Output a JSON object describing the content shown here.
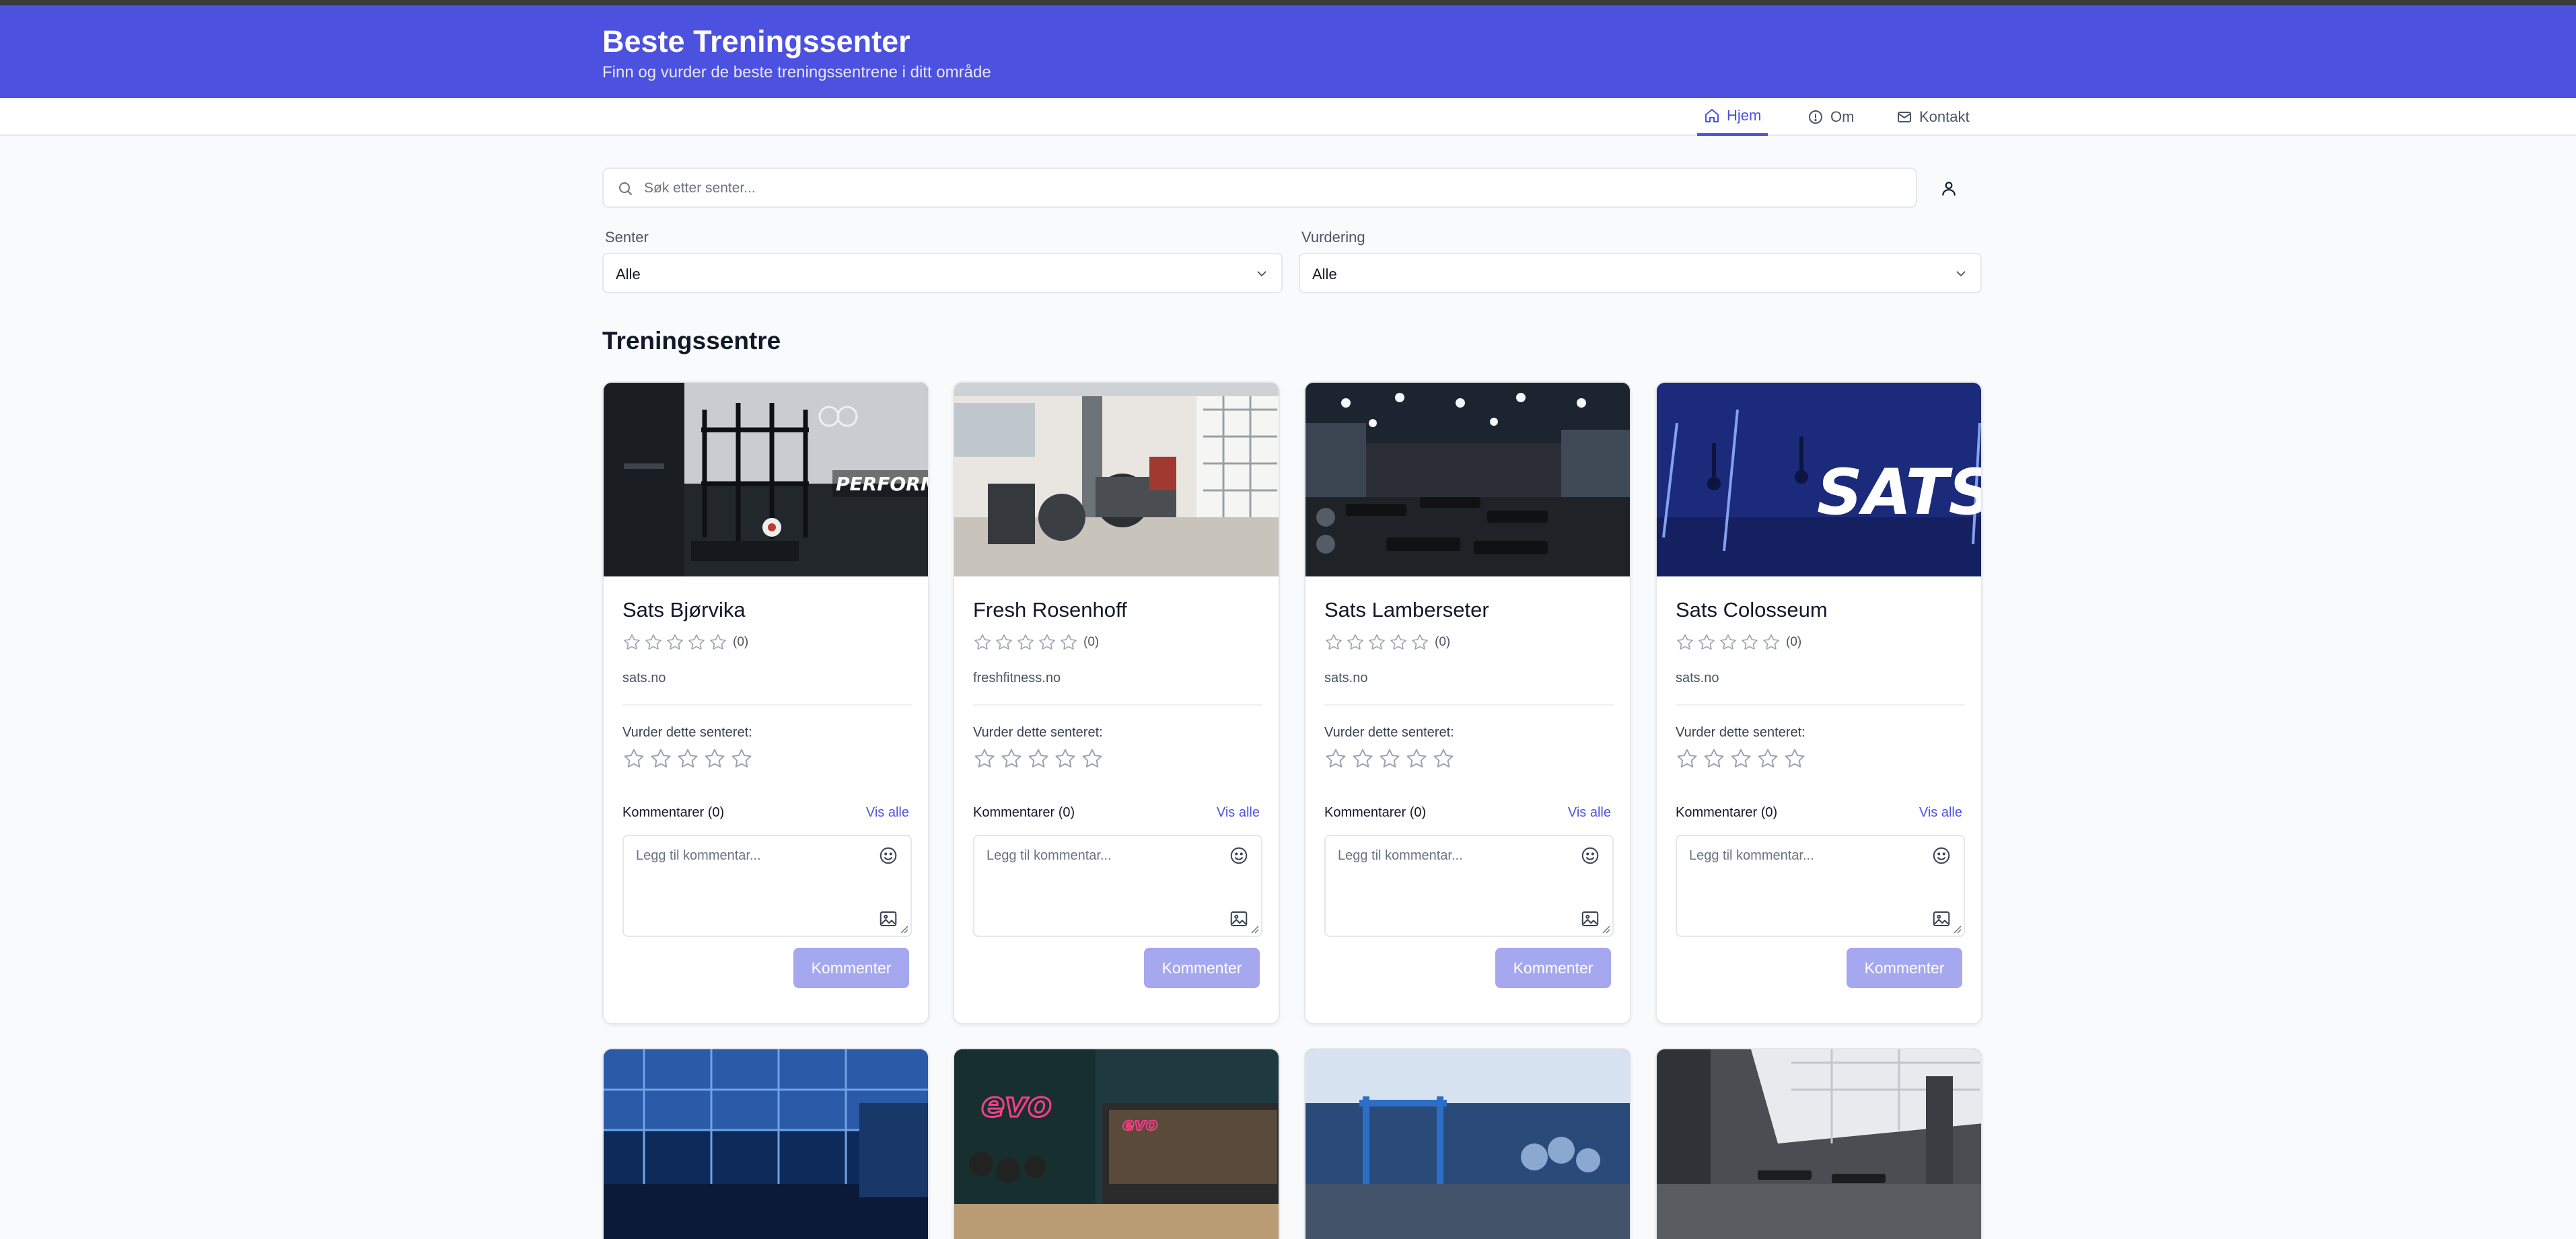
{
  "header": {
    "title": "Beste Treningssenter",
    "subtitle": "Finn og vurder de beste treningssentrene i ditt område"
  },
  "nav": {
    "items": [
      {
        "label": "Hjem",
        "icon": "home-icon",
        "active": true
      },
      {
        "label": "Om",
        "icon": "info-icon",
        "active": false
      },
      {
        "label": "Kontakt",
        "icon": "mail-icon",
        "active": false
      }
    ]
  },
  "search": {
    "placeholder": "Søk etter senter...",
    "value": ""
  },
  "filters": {
    "center": {
      "label": "Senter",
      "selected": "Alle"
    },
    "rating": {
      "label": "Vurdering",
      "selected": "Alle"
    }
  },
  "section_title": "Treningssentre",
  "card_texts": {
    "rate_label": "Vurder dette senteret:",
    "view_all": "Vis alle",
    "comment_placeholder": "Legg til kommentar...",
    "submit_label": "Kommenter"
  },
  "centers": [
    {
      "name": "Sats Bjørvika",
      "rating_count": "(0)",
      "url": "sats.no",
      "comments_label": "Kommentarer (0)",
      "rating": 0
    },
    {
      "name": "Fresh Rosenhoff",
      "rating_count": "(0)",
      "url": "freshfitness.no",
      "comments_label": "Kommentarer (0)",
      "rating": 0
    },
    {
      "name": "Sats Lamberseter",
      "rating_count": "(0)",
      "url": "sats.no",
      "comments_label": "Kommentarer (0)",
      "rating": 0
    },
    {
      "name": "Sats Colosseum",
      "rating_count": "(0)",
      "url": "sats.no",
      "comments_label": "Kommentarer (0)",
      "rating": 0
    }
  ],
  "image_signs": {
    "card1": "PERFORMANCE",
    "card4": "SATS",
    "card6a": "evo",
    "card6b": "evo"
  },
  "colors": {
    "brand": "#4c51e0",
    "button_disabled": "#a5a8ef",
    "page_bg": "#f8fafc"
  }
}
